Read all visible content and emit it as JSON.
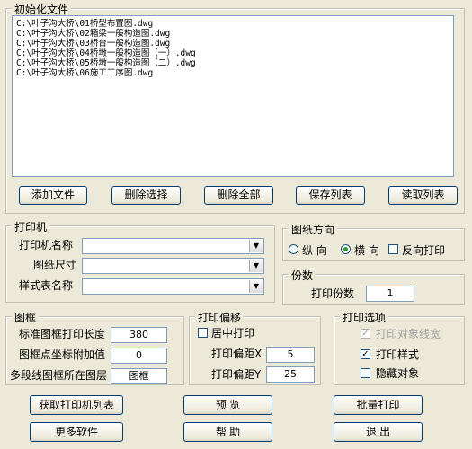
{
  "init_files": {
    "title": "初始化文件",
    "files": [
      "C:\\叶子沟大桥\\01桥型布置图.dwg",
      "C:\\叶子沟大桥\\02箱梁一般构造图.dwg",
      "C:\\叶子沟大桥\\03桥台一般构造图.dwg",
      "C:\\叶子沟大桥\\04桥墩一般构造图（一）.dwg",
      "C:\\叶子沟大桥\\05桥墩一般构造图（二）.dwg",
      "C:\\叶子沟大桥\\06施工工序图.dwg"
    ]
  },
  "file_buttons": {
    "add": "添加文件",
    "remove_selected": "删除选择",
    "remove_all": "删除全部",
    "save_list": "保存列表",
    "load_list": "读取列表"
  },
  "printer": {
    "title": "打印机",
    "name_label": "打印机名称",
    "paper_label": "图纸尺寸",
    "style_label": "样式表名称"
  },
  "orientation": {
    "title": "图纸方向",
    "portrait": "纵 向",
    "landscape": "横 向",
    "reverse": "反向打印",
    "selected": "landscape"
  },
  "copies": {
    "title": "份数",
    "label": "打印份数",
    "value": "1"
  },
  "frame": {
    "title": "图框",
    "std_length_label": "标准图框打印长度",
    "std_length_value": "380",
    "coord_add_label": "图框点坐标附加值",
    "coord_add_value": "0",
    "layer_label": "多段线图框所在图层",
    "layer_value": "图框"
  },
  "offset": {
    "title": "打印偏移",
    "center_label": "居中打印",
    "x_label": "打印偏距X",
    "x_value": "5",
    "y_label": "打印偏距Y",
    "y_value": "25"
  },
  "options": {
    "title": "打印选项",
    "lineweight": "打印对象线宽",
    "plot_style": "打印样式",
    "hide_objects": "隐藏对象"
  },
  "actions": {
    "get_printers": "获取打印机列表",
    "preview": "预 览",
    "batch_print": "批量打印",
    "more_software": "更多软件",
    "help": "帮 助",
    "exit": "退 出"
  }
}
